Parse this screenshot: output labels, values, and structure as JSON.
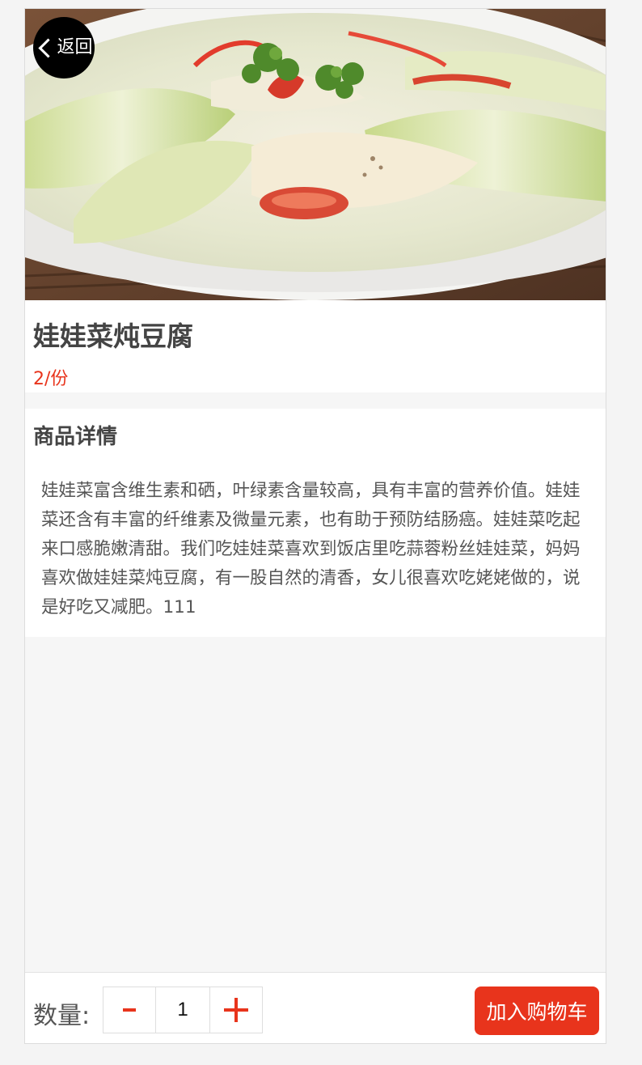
{
  "header": {
    "back_label": "返回"
  },
  "product": {
    "image_alt": "娃娃菜炖豆腐",
    "name": "娃娃菜炖豆腐",
    "price": "2/份"
  },
  "detail": {
    "heading": "商品详情",
    "description": "娃娃菜富含维生素和硒，叶绿素含量较高，具有丰富的营养价值。娃娃菜还含有丰富的纤维素及微量元素，也有助于预防结肠癌。娃娃菜吃起来口感脆嫩清甜。我们吃娃娃菜喜欢到饭店里吃蒜蓉粉丝娃娃菜，妈妈喜欢做娃娃菜炖豆腐，有一股自然的清香，女儿很喜欢吃姥姥做的，说是好吃又减肥。111"
  },
  "cart": {
    "quantity_label": "数量:",
    "quantity_value": "1",
    "add_to_cart_label": "加入购物车"
  },
  "icons": {
    "back": "chevron-left-icon",
    "minus": "minus-icon",
    "plus": "plus-icon"
  },
  "colors": {
    "accent": "#e8341c",
    "back_button_bg": "#000000",
    "page_bg": "#f6f6f6"
  }
}
